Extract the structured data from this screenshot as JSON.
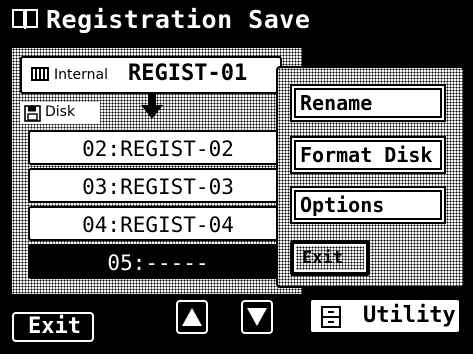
{
  "title": "Registration Save",
  "internal": {
    "label": "Internal",
    "value": "REGIST-01"
  },
  "disk": {
    "label": "Disk"
  },
  "list": [
    "02:REGIST-02",
    "03:REGIST-03",
    "04:REGIST-04",
    "05:-----"
  ],
  "selected_index": 3,
  "popup_menu": {
    "rename": "Rename",
    "format_disk": "Format Disk",
    "options": "Options",
    "exit": "Exit"
  },
  "exit_label": "Exit",
  "utility_label": "Utility",
  "icons": {
    "title": "book-icon",
    "internal": "keyboard-icon",
    "disk": "floppy-disk-icon",
    "arrow": "arrow-down-icon",
    "scroll_up": "triangle-up-icon",
    "scroll_down": "triangle-down-icon",
    "utility": "cabinet-icon"
  }
}
